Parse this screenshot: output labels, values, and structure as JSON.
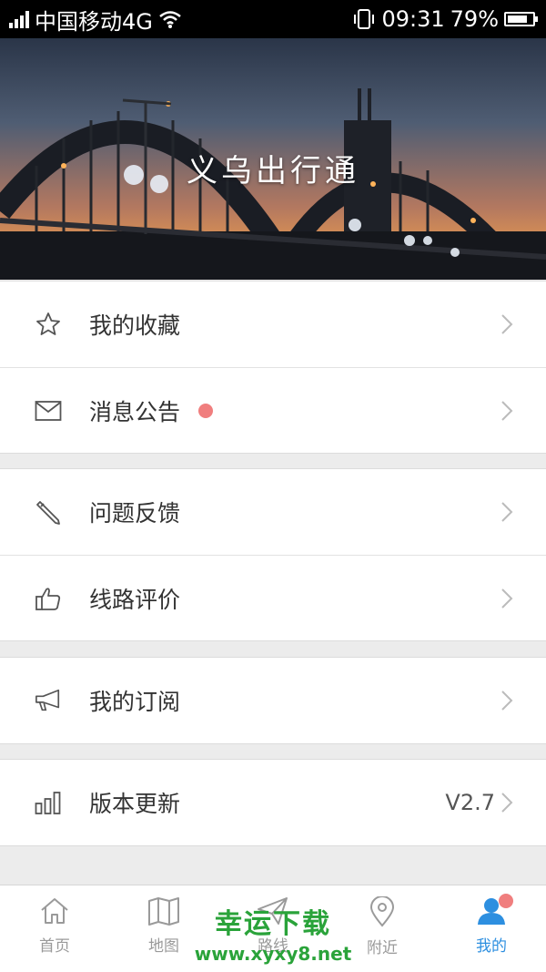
{
  "status_bar": {
    "carrier": "中国移动4G",
    "time": "09:31",
    "battery": "79%",
    "battery_level": 0.79
  },
  "hero": {
    "title": "义乌出行通"
  },
  "menu": {
    "favorites": "我的收藏",
    "notices": "消息公告",
    "feedback": "问题反馈",
    "route_rating": "线路评价",
    "subscriptions": "我的订阅",
    "update": "版本更新",
    "version": "V2.7"
  },
  "tabbar": {
    "home": "首页",
    "map": "地图",
    "route": "路线",
    "nearby": "附近",
    "mine": "我的"
  },
  "watermark": {
    "line1": "幸运下载",
    "line2": "www.xyxy8.net"
  },
  "colors": {
    "accent": "#2d8fe0",
    "badge": "#f07e7e",
    "watermark": "#2aa33a"
  }
}
